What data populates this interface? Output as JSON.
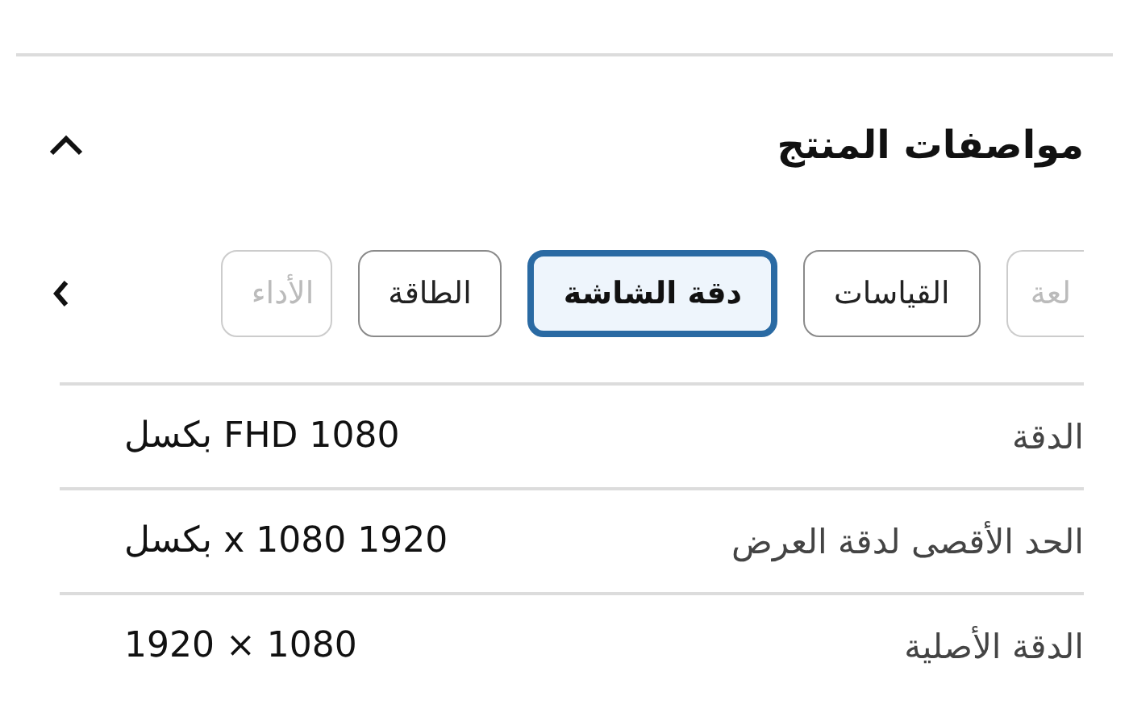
{
  "section": {
    "title": "مواصفات المنتج",
    "expanded": true
  },
  "tabs": [
    {
      "label": "لعة",
      "selected": false,
      "partial": true
    },
    {
      "label": "القياسات",
      "selected": false,
      "partial": false
    },
    {
      "label": "دقة الشاشة",
      "selected": true,
      "partial": false
    },
    {
      "label": "الطاقة",
      "selected": false,
      "partial": false
    },
    {
      "label": "الأداء",
      "selected": false,
      "partial": true
    }
  ],
  "specs": [
    {
      "label": "الدقة",
      "value": "1080 FHD بكسل"
    },
    {
      "label": "الحد الأقصى لدقة العرض",
      "value": "1920 1080 x بكسل"
    },
    {
      "label": "الدقة الأصلية",
      "value": "1080 × 1920"
    }
  ]
}
